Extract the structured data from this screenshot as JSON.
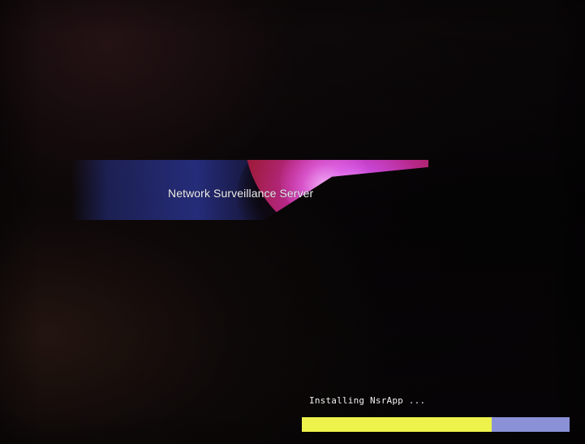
{
  "screen": {
    "title": "Network Surveillance Server",
    "status_text": "Installing NsrApp ...",
    "progress": {
      "percent": 71,
      "fill_color": "#eef34b",
      "track_color": "#8b91d7"
    },
    "theme": {
      "accent_blue": "#2c379a",
      "accent_magenta": "#d34ae1",
      "accent_red": "#a71d41"
    }
  }
}
